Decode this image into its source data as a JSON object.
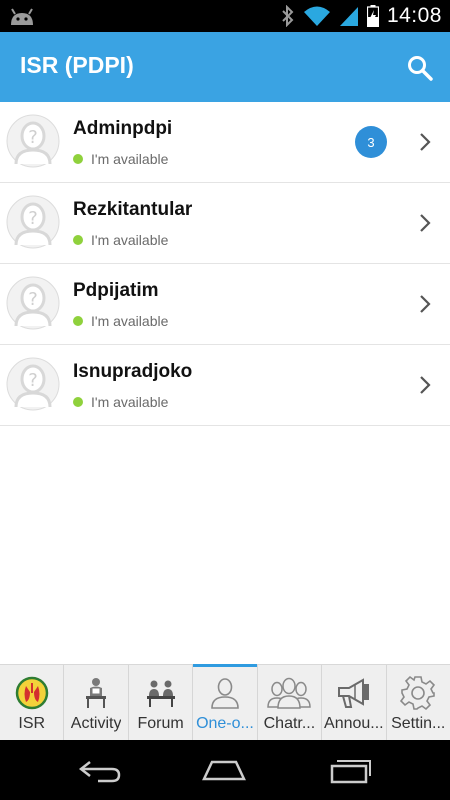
{
  "status_bar": {
    "time": "14:08"
  },
  "app_bar": {
    "title": "ISR (PDPI)"
  },
  "contacts": [
    {
      "name": "Adminpdpi",
      "status": "I'm available",
      "unread": "3"
    },
    {
      "name": "Rezkitantular",
      "status": "I'm available",
      "unread": ""
    },
    {
      "name": "Pdpijatim",
      "status": "I'm available",
      "unread": ""
    },
    {
      "name": "Isnupradjoko",
      "status": "I'm available",
      "unread": ""
    }
  ],
  "tabs": [
    {
      "label": "ISR",
      "icon": "isr-logo-icon",
      "active": false
    },
    {
      "label": "Activity",
      "icon": "presenter-icon",
      "active": false
    },
    {
      "label": "Forum",
      "icon": "meeting-icon",
      "active": false
    },
    {
      "label": "One-o...",
      "icon": "person-icon",
      "active": true
    },
    {
      "label": "Chatr...",
      "icon": "group-icon",
      "active": false
    },
    {
      "label": "Annou...",
      "icon": "megaphone-icon",
      "active": false
    },
    {
      "label": "Settin...",
      "icon": "gear-icon",
      "active": false
    }
  ],
  "colors": {
    "app_bar": "#3aa3e3",
    "badge": "#2f8fd8",
    "available_dot": "#8fd13c",
    "active_tab": "#2f8fd8"
  }
}
